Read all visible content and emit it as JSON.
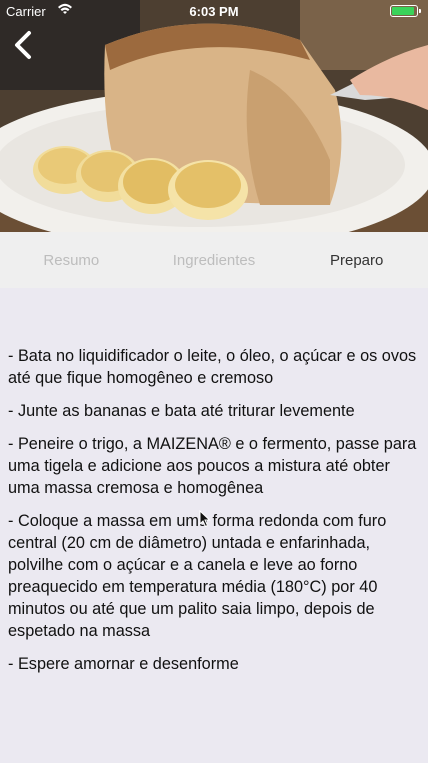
{
  "status_bar": {
    "carrier": "Carrier",
    "time": "6:03 PM",
    "battery_level": 0.85,
    "battery_color": "#3ad35a"
  },
  "header": {
    "back_icon": "chevron-left-icon"
  },
  "tabs": [
    {
      "label": "Resumo",
      "active": false
    },
    {
      "label": "Ingredientes",
      "active": false
    },
    {
      "label": "Preparo",
      "active": true
    }
  ],
  "steps": [
    "- Bata no liquidificador o leite, o óleo, o açúcar e os ovos até que fique homogêneo e cremoso",
    "- Junte as bananas e bata até triturar levemente",
    "- Peneire o trigo, a MAIZENA® e o fermento, passe para uma tigela e adicione aos poucos a mistura até obter uma massa cremosa e homogênea",
    "- Coloque a massa em uma forma redonda com furo central (20 cm de diâmetro) untada e enfarinhada, polvilhe com o açúcar e a canela e leve ao forno preaquecido em temperatura média (180°C) por 40 minutos ou até que um palito saia limpo, depois de espetado na massa",
    "- Espere amornar e desenforme"
  ]
}
